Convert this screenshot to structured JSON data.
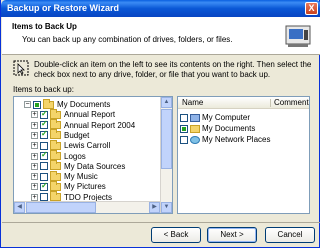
{
  "window": {
    "title": "Backup or Restore Wizard",
    "close_glyph": "X"
  },
  "header": {
    "title": "Items to Back Up",
    "subtitle": "You can back up any combination of drives, folders, or files."
  },
  "instructions": "Double-click an item on the left to see its contents on the right. Then select the check box next to any drive, folder, or file that you want to back up.",
  "tree": {
    "label": "Items to back up:",
    "items": [
      {
        "label": "My Documents",
        "state": "partial",
        "expander": "−",
        "level": 0
      },
      {
        "label": "Annual Report",
        "state": "checked",
        "expander": "+",
        "level": 1
      },
      {
        "label": "Annual Report 2004",
        "state": "checked",
        "expander": "+",
        "level": 1
      },
      {
        "label": "Budget",
        "state": "checked",
        "expander": "+",
        "level": 1
      },
      {
        "label": "Lewis Carroll",
        "state": "unchecked",
        "expander": "+",
        "level": 1
      },
      {
        "label": "Logos",
        "state": "checked",
        "expander": "+",
        "level": 1
      },
      {
        "label": "My Data Sources",
        "state": "unchecked",
        "expander": "+",
        "level": 1
      },
      {
        "label": "My Music",
        "state": "unchecked",
        "expander": "+",
        "level": 1
      },
      {
        "label": "My Pictures",
        "state": "checked",
        "expander": "+",
        "level": 1
      },
      {
        "label": "TDO Projects",
        "state": "unchecked",
        "expander": "+",
        "level": 1
      }
    ]
  },
  "list": {
    "columns": [
      "Name",
      "Comment"
    ],
    "rows": [
      {
        "label": "My Computer",
        "state": "unchecked",
        "icon": "computer-icon"
      },
      {
        "label": "My Documents",
        "state": "partial",
        "icon": "folder-icon"
      },
      {
        "label": "My Network Places",
        "state": "unchecked",
        "icon": "network-icon"
      }
    ]
  },
  "buttons": {
    "back": "< Back",
    "next": "Next >",
    "cancel": "Cancel"
  },
  "colors": {
    "titlebar": "#0a57d6",
    "accent": "#316ac5",
    "check": "#21a121"
  }
}
